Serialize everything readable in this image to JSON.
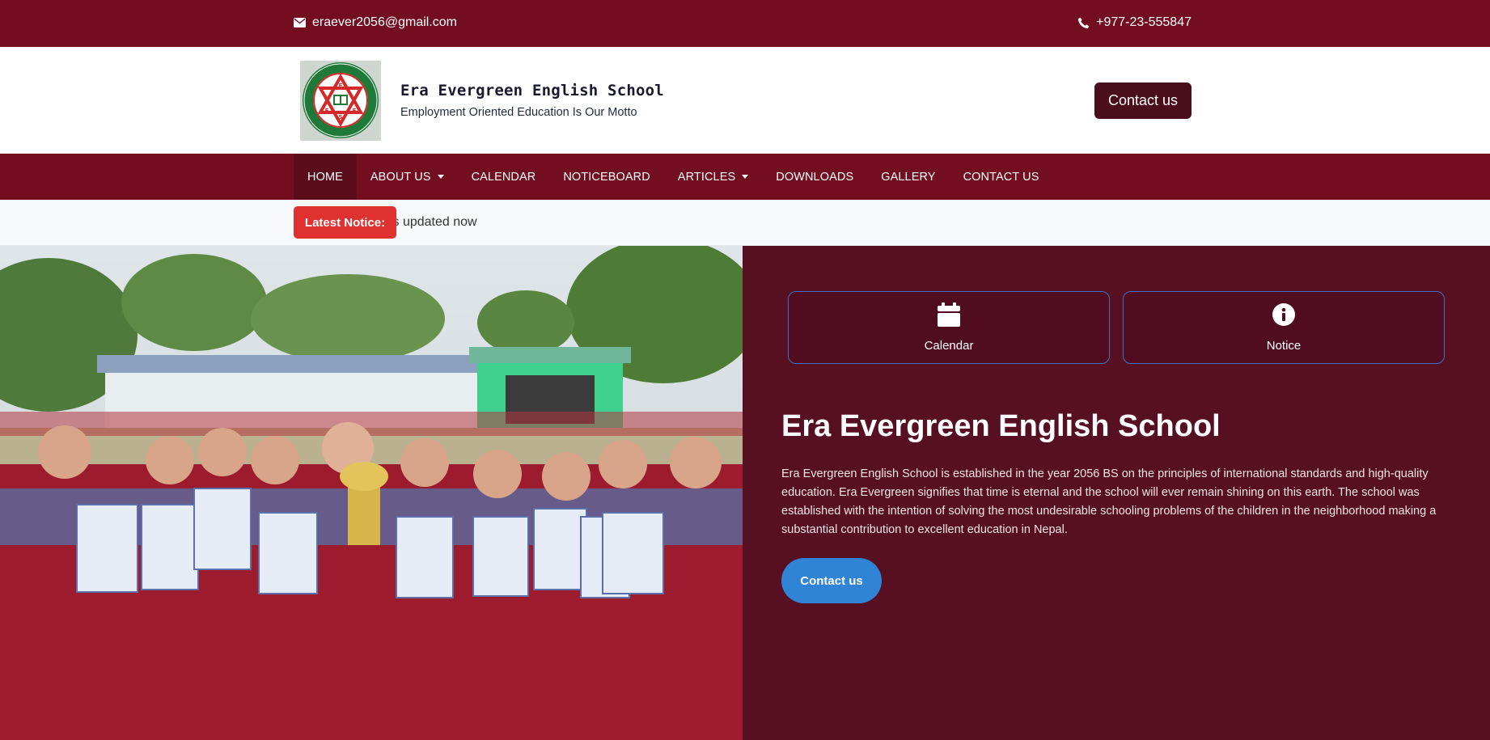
{
  "topbar": {
    "email": "eraever2056@gmail.com",
    "phone": "+977-23-555847",
    "email_icon": "envelope-icon",
    "phone_icon": "phone-icon"
  },
  "header": {
    "school_name": "Era Evergreen English School",
    "motto": "Employment Oriented Education Is Our Motto",
    "contact_button": "Contact us",
    "logo_text_top": "ERA EVERGREEN ENGLISH SCHOOL",
    "logo_text_bottom": "BUDDHASHANTI-3, JHAPA",
    "logo_letters": [
      "E",
      "E",
      "E",
      "S"
    ]
  },
  "nav": {
    "items": [
      {
        "label": "HOME",
        "active": true
      },
      {
        "label": "ABOUT US",
        "dropdown": true
      },
      {
        "label": "CALENDAR"
      },
      {
        "label": "NOTICEBOARD"
      },
      {
        "label": "ARTICLES",
        "dropdown": true
      },
      {
        "label": "DOWNLOADS"
      },
      {
        "label": "GALLERY"
      },
      {
        "label": "CONTACT US"
      }
    ]
  },
  "notice": {
    "label": "Latest Notice:",
    "text": "Website is updated now"
  },
  "hero": {
    "cards": [
      {
        "label": "Calendar",
        "icon": "calendar-icon"
      },
      {
        "label": "Notice",
        "icon": "info-circle-icon"
      }
    ],
    "title": "Era Evergreen English School",
    "description": "Era Evergreen English School is established in the year 2056 BS on the principles of international standards and high-quality education. Era Evergreen signifies that time is eternal and the school will ever remain shining on this earth. The school was established with the intention of solving the most undesirable schooling problems of the children in the neighborhood making a substantial contribution to excellent education in Nepal.",
    "button": "Contact us"
  },
  "colors": {
    "brand_maroon": "#720e20",
    "hero_bg": "#570f22",
    "notice_red": "#e03131",
    "button_blue": "#2f84d6"
  }
}
